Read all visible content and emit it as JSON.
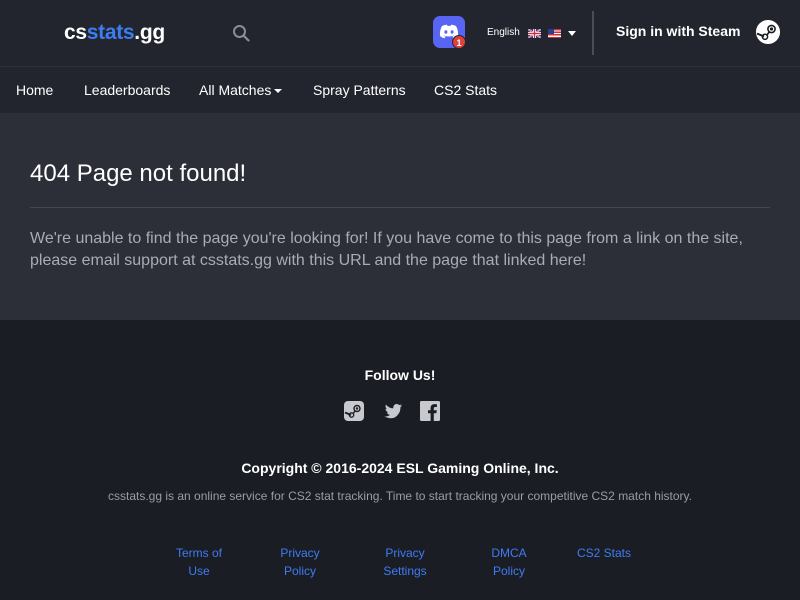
{
  "header": {
    "logo": {
      "part1": "cs",
      "part2": "stats",
      "part3": ".gg"
    },
    "search_icon": "search-icon",
    "discord": {
      "icon": "discord-icon",
      "badge_count": "1"
    },
    "language": {
      "label": "English",
      "flags": [
        "uk-flag-icon",
        "us-flag-icon"
      ]
    },
    "signin_label": "Sign in with Steam",
    "steam_icon": "steam-icon"
  },
  "nav": {
    "items": [
      {
        "label": "Home"
      },
      {
        "label": "Leaderboards"
      },
      {
        "label": "All Matches",
        "dropdown": true
      },
      {
        "label": "Spray Patterns"
      },
      {
        "label": "CS2 Stats"
      }
    ]
  },
  "main": {
    "title": "404 Page not found!",
    "message": "We're unable to find the page you're looking for! If you have come to this page from a link on the site, please email support at csstats.gg with this URL and the page that linked here!"
  },
  "footer": {
    "follow_label": "Follow Us!",
    "social": [
      "steam-icon",
      "twitter-icon",
      "facebook-icon"
    ],
    "copyright": "Copyright © 2016-2024 ESL Gaming Online, Inc.",
    "tagline": "csstats.gg is an online service for CS2 stat tracking. Time to start tracking your competitive CS2 match history.",
    "links": [
      {
        "line1": "Terms of",
        "line2": "Use"
      },
      {
        "line1": "Privacy",
        "line2": "Policy"
      },
      {
        "line1": "Privacy",
        "line2": "Settings"
      },
      {
        "line1": "DMCA",
        "line2": "Policy"
      },
      {
        "line1": "CS2 Stats",
        "line2": ""
      }
    ]
  },
  "colors": {
    "accent_blue": "#3d7cf2",
    "header_bg": "#23252e",
    "main_bg": "#2c2e38",
    "footer_bg": "#1b1d25",
    "discord": "#5865f2",
    "badge": "#e2403a"
  }
}
